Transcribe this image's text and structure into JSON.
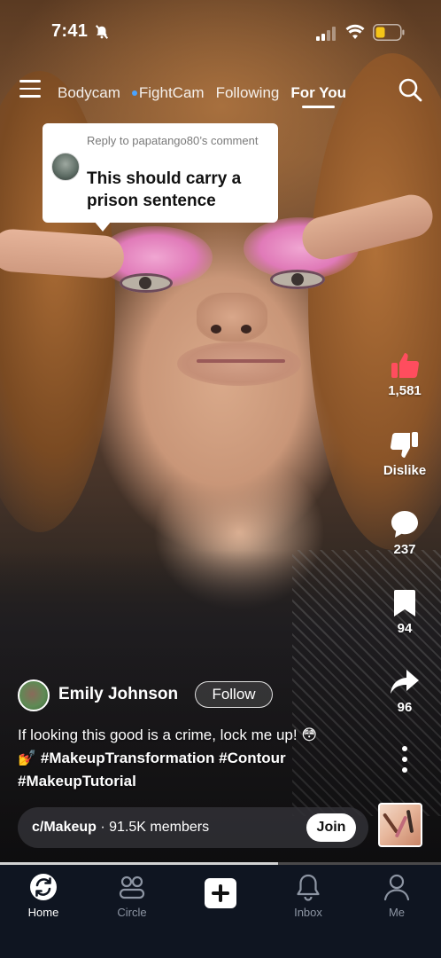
{
  "status_bar": {
    "time": "7:41",
    "battery_color": "#f5c518"
  },
  "top_nav": {
    "tabs": [
      {
        "label": "Bodycam",
        "active": false
      },
      {
        "label": "FightCam",
        "active": false,
        "dot": true
      },
      {
        "label": "Following",
        "active": false
      },
      {
        "label": "For You",
        "active": true
      }
    ]
  },
  "reply": {
    "meta": "Reply to papatango80’s comment",
    "text": "This should carry a prison sentence"
  },
  "actions": {
    "like_count": "1,581",
    "like_color": "#ff4d5e",
    "dislike_label": "Dislike",
    "comment_count": "237",
    "save_count": "94",
    "share_count": "96"
  },
  "author": {
    "name": "Emily Johnson",
    "follow_label": "Follow"
  },
  "caption": {
    "text": "If looking this good is a crime, lock me up!",
    "emoji_1": "😳",
    "emoji_2": "💅",
    "tags_line1": "#MakeupTransformation #Contour",
    "tags_line2": "#MakeupTutorial"
  },
  "community": {
    "name": "c/Makeup",
    "members": " · 91.5K members",
    "join_label": "Join"
  },
  "progress": {
    "fraction": 0.63
  },
  "tab_bar": {
    "tabs": [
      {
        "label": "Home",
        "icon": "home-icon",
        "active": true
      },
      {
        "label": "Circle",
        "icon": "circle-icon",
        "active": false
      },
      {
        "label": "",
        "icon": "create-icon",
        "active": false
      },
      {
        "label": "Inbox",
        "icon": "bell-icon",
        "active": false
      },
      {
        "label": "Me",
        "icon": "person-icon",
        "active": false
      }
    ]
  }
}
